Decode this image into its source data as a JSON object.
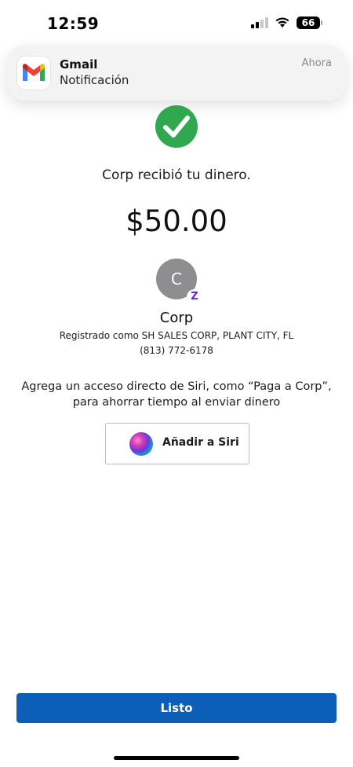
{
  "status_bar": {
    "time": "12:59",
    "battery": "66"
  },
  "notification": {
    "app": "Gmail",
    "body": "Notificación",
    "time": "Ahora"
  },
  "payment": {
    "message": "Corp recibió tu dinero.",
    "amount": "$50.00",
    "avatar_initial": "C",
    "badge_symbol": "Z",
    "recipient_name": "Corp",
    "registered_as": "Registrado como SH SALES CORP, PLANT CITY, FL",
    "phone": "(813) 772-6178"
  },
  "siri": {
    "description": "Agrega un acceso directo de Siri, como “Paga a Corp”, para ahorrar tiempo al enviar dinero",
    "button_label": "Añadir a Siri"
  },
  "footer": {
    "done_label": "Listo"
  },
  "colors": {
    "success_green": "#2fa84f",
    "primary_blue": "#0c5eb6",
    "zelle_purple": "#6d1ed4",
    "avatar_gray": "#8e8e90"
  }
}
